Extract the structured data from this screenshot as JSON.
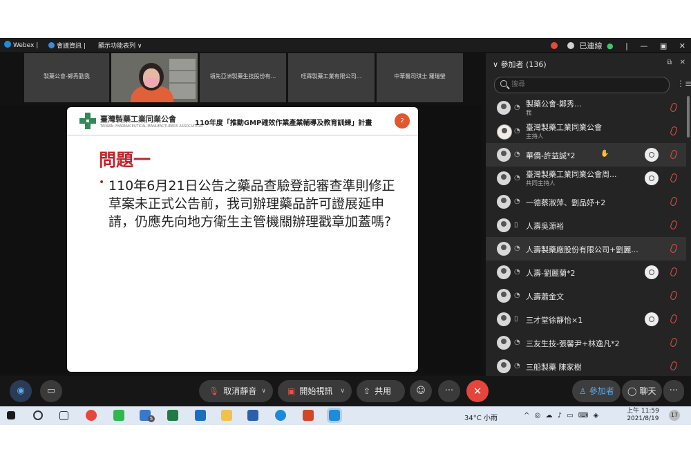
{
  "titlebar": {
    "app_name": "Webex",
    "meeting_info": "會議資訊",
    "layout_menu": "顯示功能表列 ∨",
    "connection_status": "已連線",
    "status_dot": "●"
  },
  "video_strip": [
    {
      "label": "製藥公會-鄭秀勤我"
    },
    {
      "label": ""
    },
    {
      "label": "領先亞洲製藥生技股份有..."
    },
    {
      "label": "旺霖製藥工業有限公司..."
    },
    {
      "label": "中華醫司琪士 羅瑞瑩"
    }
  ],
  "slide": {
    "org_name": "臺灣製藥工業同業公會",
    "org_name_en": "TAIWAN PHARMACEUTICAL MANUFACTURERS ASSOCIATION",
    "program_title": "110年度「推動GMP確效作業產業輔導及教育訓練」計畫",
    "page_number": "2",
    "question_title": "問題一",
    "bullet": "•",
    "question_body": "110年6月21日公告之藥品查驗登記審查準則修正草案未正式公告前，我司辦理藥品許可證展延申請，仍應先向地方衛生主管機關辦理戳章加蓋嗎?"
  },
  "participants": {
    "header": "參加者 (136)",
    "search_placeholder": "搜尋",
    "items": [
      {
        "name": "製藥公會-鄭秀...",
        "role": "我",
        "video": false
      },
      {
        "name": "臺灣製藥工業同業公會",
        "role": "主持人",
        "video": false
      },
      {
        "name": "華僑-許益誠*2",
        "role": "",
        "video": true,
        "hand": "✋"
      },
      {
        "name": "臺灣製藥工業同業公會周...",
        "role": "共同主持人",
        "video": true
      },
      {
        "name": "一德蔡淑萍、劉品妤+2",
        "role": "",
        "video": false
      },
      {
        "name": "人壽吳源裕",
        "role": "",
        "video": false
      },
      {
        "name": "人壽製藥廠股份有限公司+劉麗...",
        "role": "",
        "video": false
      },
      {
        "name": "人壽-劉麗蘭*2",
        "role": "",
        "video": true
      },
      {
        "name": "人壽蕭金文",
        "role": "",
        "video": false
      },
      {
        "name": "三才堂徐靜怡×1",
        "role": "",
        "video": true
      },
      {
        "name": "三友生技-張馨尹+林逸凡*2",
        "role": "",
        "video": false
      },
      {
        "name": "三船製藥 陳家樹",
        "role": "",
        "video": false
      }
    ]
  },
  "controls": {
    "unmute_label": "取消靜音",
    "start_video_label": "開始視訊",
    "share_label": "共用",
    "participants_label": "參加者",
    "chat_label": "聊天",
    "more_label": "···",
    "leave_icon": "✕"
  },
  "taskbar": {
    "weather": "34°C 小雨",
    "time": "上午 11:59",
    "date": "2021/8/19",
    "notifications": "17",
    "mail_badge": "5",
    "tray_icons": "^ ◎ ☁ ♪ ▭ ⌨ ◈"
  },
  "colors": {
    "accent_red": "#e5453a",
    "slide_title_red": "#c0252b",
    "webex_blue": "#1d8dd9"
  }
}
